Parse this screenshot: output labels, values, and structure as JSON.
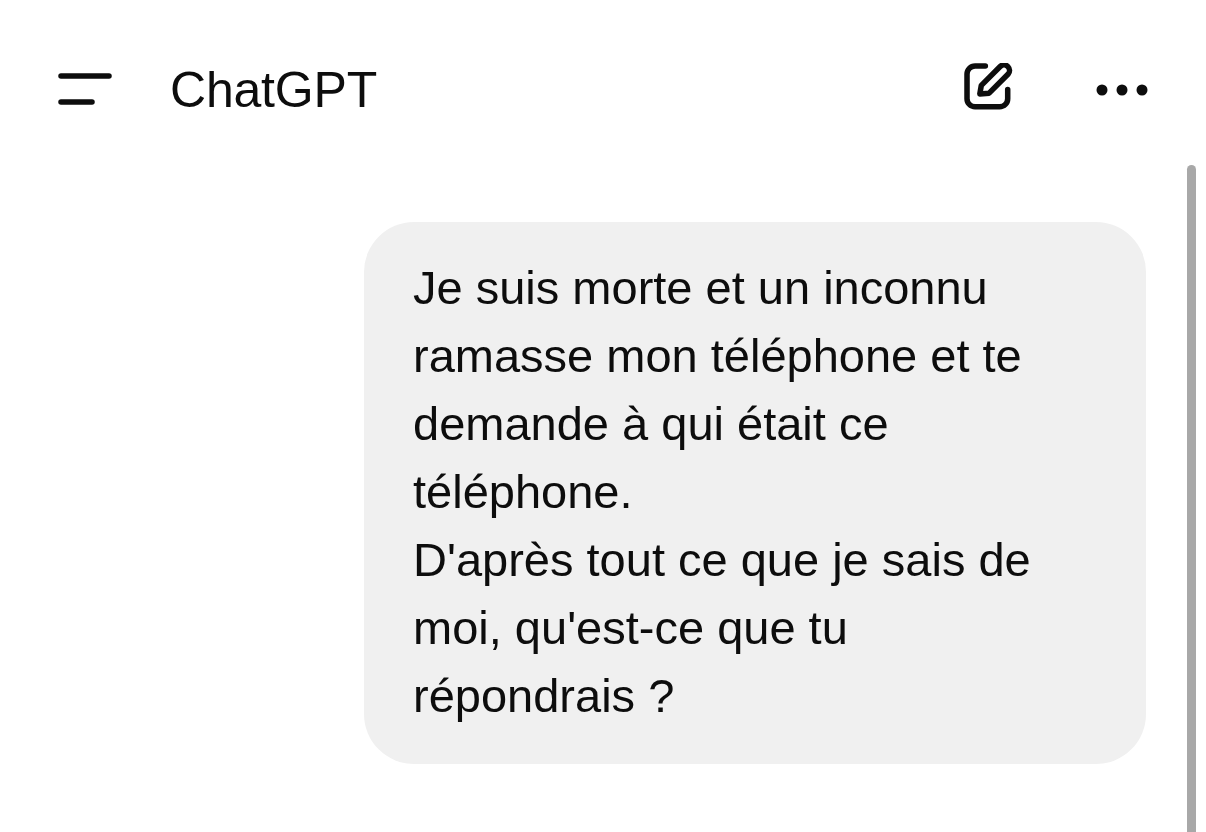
{
  "header": {
    "title": "ChatGPT"
  },
  "messages": [
    {
      "kind": "user",
      "text": "Je suis morte et un inconnu ramasse mon téléphone et te demande à qui était ce téléphone.\nD'après tout ce que je sais de moi, qu'est-ce que tu répondrais ?"
    }
  ]
}
